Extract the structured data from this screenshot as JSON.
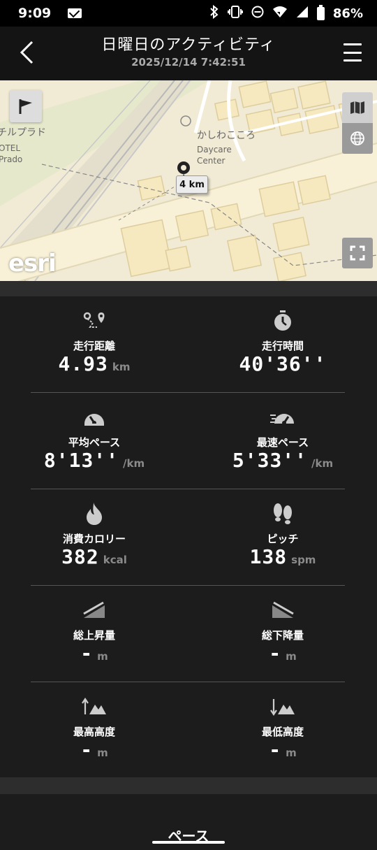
{
  "status_bar": {
    "time": "9:09",
    "battery": "86%",
    "icons": [
      "mail-icon",
      "bluetooth-icon",
      "vibrate-icon",
      "dnd-icon",
      "wifi-icon",
      "signal-icon",
      "battery-icon"
    ]
  },
  "header": {
    "title": "日曜日のアクティビティ",
    "subtitle": "2025/12/14 7:42:51"
  },
  "map": {
    "labels": {
      "place1": "かしわこころ",
      "place2": "Daycare",
      "place3": "Center",
      "place4": "チルプラド",
      "place5": "OTEL",
      "place6": "Prado"
    },
    "km_marker": "4 km",
    "attribution": "esri"
  },
  "stats": {
    "distance": {
      "label": "走行距離",
      "value": "4.93",
      "unit": "km",
      "icon": "route-icon"
    },
    "time": {
      "label": "走行時間",
      "value": "40'36''",
      "unit": "",
      "icon": "stopwatch-icon"
    },
    "avg_pace": {
      "label": "平均ペース",
      "value": "8'13''",
      "unit": "/km",
      "icon": "speedometer-icon"
    },
    "best_pace": {
      "label": "最速ペース",
      "value": "5'33''",
      "unit": "/km",
      "icon": "fast-speedometer-icon"
    },
    "calories": {
      "label": "消費カロリー",
      "value": "382",
      "unit": "kcal",
      "icon": "flame-icon"
    },
    "pitch": {
      "label": "ピッチ",
      "value": "138",
      "unit": "spm",
      "icon": "footprints-icon"
    },
    "ascent": {
      "label": "総上昇量",
      "value": "-",
      "unit": "m",
      "icon": "ascent-icon"
    },
    "descent": {
      "label": "総下降量",
      "value": "-",
      "unit": "m",
      "icon": "descent-icon"
    },
    "max_alt": {
      "label": "最高高度",
      "value": "-",
      "unit": "m",
      "icon": "max-altitude-icon"
    },
    "min_alt": {
      "label": "最低高度",
      "value": "-",
      "unit": "m",
      "icon": "min-altitude-icon"
    }
  },
  "bottom": {
    "section_title": "ペース"
  }
}
